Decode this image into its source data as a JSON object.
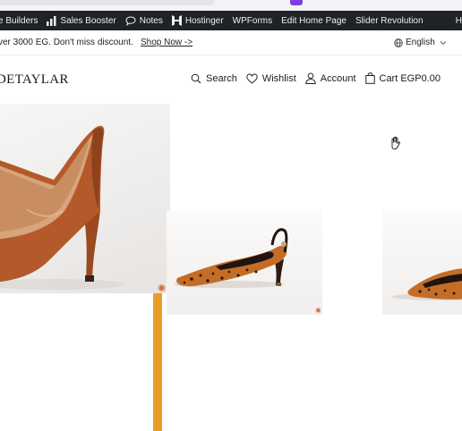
{
  "admin_bar": {
    "items": [
      {
        "label": "e Builders",
        "icon": ""
      },
      {
        "label": "Sales Booster",
        "icon": "bar-chart-icon"
      },
      {
        "label": "Notes",
        "icon": "comment-icon"
      },
      {
        "label": "Hostinger",
        "icon": "hostinger-icon"
      },
      {
        "label": "WPForms",
        "icon": ""
      },
      {
        "label": "Edit Home Page",
        "icon": ""
      },
      {
        "label": "Slider Revolution",
        "icon": ""
      }
    ],
    "right_label": "H"
  },
  "promo": {
    "message": "ver 3000 EG. Don't miss discount.",
    "link": "Shop Now ->",
    "language": "English"
  },
  "header": {
    "logo": "DETAYLAR",
    "nav": {
      "search": "Search",
      "wishlist": "Wishlist",
      "account": "Account",
      "cart": "Cart EGP0.00"
    }
  },
  "colors": {
    "admin_bar_bg": "#1d2327",
    "accent_orange": "#e99d27",
    "leather_brown": "#b45a2a"
  }
}
